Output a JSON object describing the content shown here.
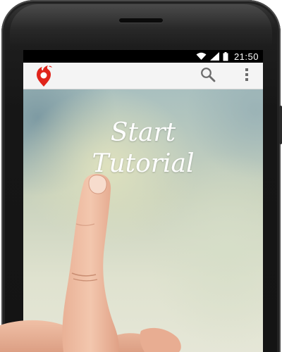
{
  "status_bar": {
    "time": "21:50",
    "icons": [
      "wifi-icon",
      "signal-icon",
      "battery-icon"
    ]
  },
  "action_bar": {
    "logo_icon": "flame-pin-logo",
    "actions": [
      "search-icon",
      "overflow-menu-icon"
    ]
  },
  "tutorial": {
    "title_line1": "Start",
    "title_line2": "Tutorial"
  },
  "colors": {
    "logo_red": "#e0241b",
    "action_bar_bg": "#f4f4f4",
    "icon_gray": "#6b6b6b"
  }
}
